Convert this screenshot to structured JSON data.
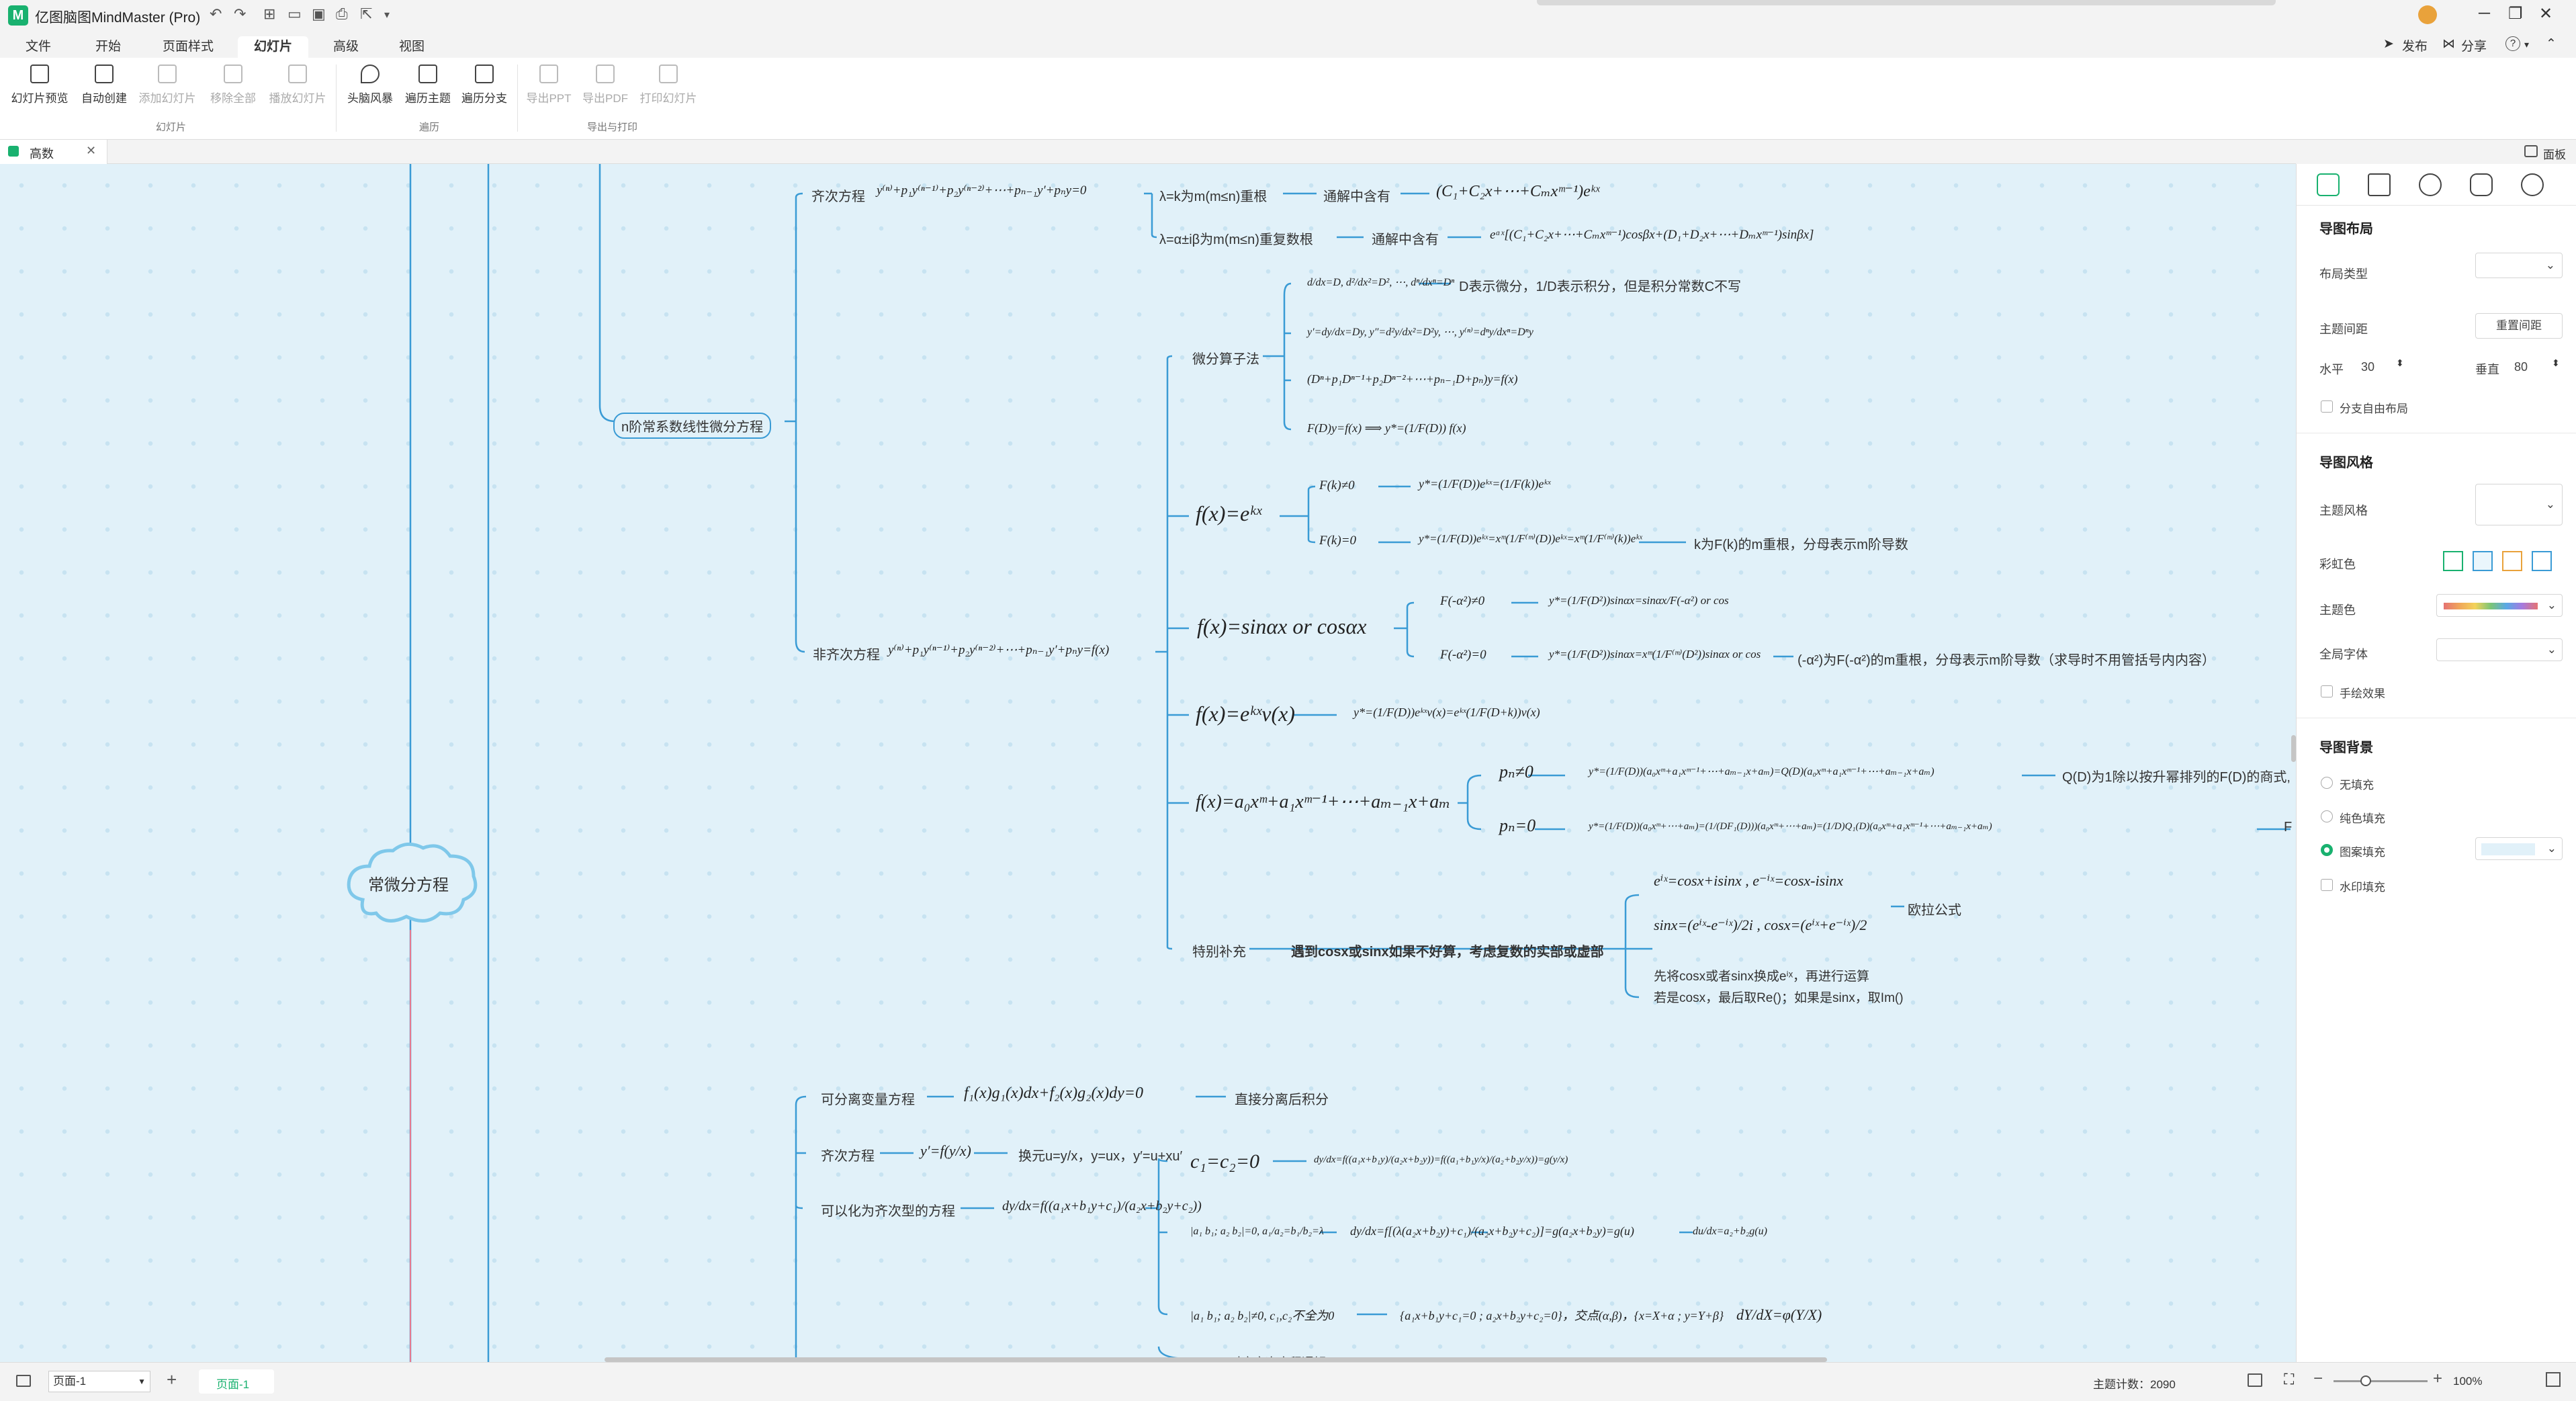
{
  "app": {
    "title": "亿图脑图MindMaster (Pro)"
  },
  "menu": {
    "tabs": [
      "文件",
      "开始",
      "页面样式",
      "幻灯片",
      "高级",
      "视图"
    ],
    "active_index": 3,
    "publish": "发布",
    "share": "分享",
    "help": "?"
  },
  "ribbon": {
    "buttons": [
      {
        "label": "幻灯片预览",
        "enabled": true
      },
      {
        "label": "自动创建",
        "enabled": true
      },
      {
        "label": "添加幻灯片",
        "enabled": false
      },
      {
        "label": "移除全部",
        "enabled": false
      },
      {
        "label": "播放幻灯片",
        "enabled": false
      },
      {
        "label": "头脑风暴",
        "enabled": true
      },
      {
        "label": "遍历主题",
        "enabled": true
      },
      {
        "label": "遍历分支",
        "enabled": true
      },
      {
        "label": "导出PPT",
        "enabled": false
      },
      {
        "label": "导出PDF",
        "enabled": false
      },
      {
        "label": "打印幻灯片",
        "enabled": false
      }
    ],
    "groups": [
      "幻灯片",
      "遍历",
      "导出与打印"
    ]
  },
  "doc": {
    "tab": "高数",
    "panel_toggle": "面板"
  },
  "map": {
    "root": "常微分方程",
    "n_order": "n阶常系数线性微分方程",
    "homog": "齐次方程",
    "homog_eq": "y⁽ⁿ⁾+p₁y⁽ⁿ⁻¹⁾+p₂y⁽ⁿ⁻²⁾+⋯+pₙ₋₁y′+pₙy=0",
    "case_real": "λ=k为m(m≤n)重根",
    "case_complex": "λ=α±iβ为m(m≤n)重复数根",
    "general_has": "通解中含有",
    "general_has2": "通解中含有",
    "sol_real": "(C₁+C₂x+⋯+Cₘxᵐ⁻¹)eᵏˣ",
    "sol_complex": "eᵅˣ[(C₁+C₂x+⋯+Cₘxᵐ⁻¹)cosβx+(D₁+D₂x+⋯+Dₘxᵐ⁻¹)sinβx]",
    "nonhomog": "非齐次方程",
    "nonhomog_eq": "y⁽ⁿ⁾+p₁y⁽ⁿ⁻¹⁾+p₂y⁽ⁿ⁻²⁾+⋯+pₙ₋₁y′+pₙy=f(x)",
    "op_method": "微分算子法",
    "op_def": "d/dx=D, d²/dx²=D², ⋯, dⁿ/dxⁿ=Dⁿ",
    "op_note": "D表示微分，1/D表示积分，但是积分常数C不写",
    "op_y": "y′=dy/dx=Dy, y″=d²y/dx²=D²y, ⋯, y⁽ⁿ⁾=dⁿy/dxⁿ=Dⁿy",
    "op_poly": "(Dⁿ+p₁Dⁿ⁻¹+p₂Dⁿ⁻²+⋯+pₙ₋₁D+pₙ)y=f(x)",
    "op_sol": "F(D)y=f(x) ⟹ y*=(1/F(D)) f(x)",
    "f_exp": "f(x)=eᵏˣ",
    "fk_ne": "F(k)≠0",
    "fk_ne_sol": "y*=(1/F(D))eᵏˣ=(1/F(k))eᵏˣ",
    "fk_eq": "F(k)=0",
    "fk_eq_sol": "y*=(1/F(D))eᵏˣ=xᵐ(1/F⁽ᵐ⁾(D))eᵏˣ=xᵐ(1/F⁽ᵐ⁾(k))eᵏˣ",
    "fk_note": "k为F(k)的m重根，分母表示m阶导数",
    "f_trig": "f(x)=sinαx or cosαx",
    "fa_ne": "F(-α²)≠0",
    "fa_ne_sol": "y*=(1/F(D²))sinαx=sinαx/F(-α²) or cos",
    "fa_eq": "F(-α²)=0",
    "fa_eq_sol": "y*=(1/F(D²))sinαx=xᵐ(1/F⁽ᵐ⁾(D²))sinαx or cos",
    "fa_note": "(-α²)为F(-α²)的m重根，分母表示m阶导数（求导时不用管括号内内容）",
    "f_expv": "f(x)=eᵏˣv(x)",
    "f_expv_sol": "y*=(1/F(D))eᵏˣv(x)=eᵏˣ(1/F(D+k))v(x)",
    "f_poly": "f(x)=a₀xᵐ+a₁xᵐ⁻¹+⋯+aₘ₋₁x+aₘ",
    "pn_ne": "pₙ≠0",
    "pn_ne_sol": "y*=(1/F(D))(a₀xᵐ+a₁xᵐ⁻¹+⋯+aₘ₋₁x+aₘ)=Q(D)(a₀xᵐ+a₁xᵐ⁻¹+⋯+aₘ₋₁x+aₘ)",
    "pn_ne_note": "Q(D)为1除以按升幂排列的F(D)的商式,",
    "pn_eq": "pₙ=0",
    "pn_eq_sol": "y*=(1/F(D))(a₀xᵐ+⋯+aₘ)=(1/(DF₁(D)))(a₀xᵐ+⋯+aₘ)=(1/D)Q₁(D)(a₀xᵐ+a₁xᵐ⁻¹+⋯+aₘ₋₁x+aₘ)",
    "pn_eq_note": "F",
    "special": "特别补充",
    "special_bold": "遇到cosx或sinx如果不好算，考虑复数的实部或虚部",
    "euler1": "eⁱˣ=cosx+isinx , e⁻ⁱˣ=cosx-isinx",
    "euler2": "sinx=(eⁱˣ-e⁻ⁱˣ)/2i , cosx=(eⁱˣ+e⁻ⁱˣ)/2",
    "euler_label": "欧拉公式",
    "special_a": "先将cosx或者sinx换成eⁱˣ，再进行运算",
    "special_b": "若是cosx，最后取Re()；如果是sinx，取Im()",
    "separable": "可分离变量方程",
    "separable_eq": "f₁(x)g₁(x)dx+f₂(x)g₂(x)dy=0",
    "separable_note": "直接分离后积分",
    "homog1": "齐次方程",
    "homog1_eq": "y′=f(y/x)",
    "homog1_note": "换元u=y/x，y=ux，y′=u+xu′",
    "reducible": "可以化为齐次型的方程",
    "reducible_eq": "dy/dx=f((a₁x+b₁y+c₁)/(a₂x+b₂y+c₂))",
    "c_zero": "c₁=c₂=0",
    "c_zero_sol": "dy/dx=f((a₁x+b₁y)/(a₂x+b₂y))=f((a₁+b₁y/x)/(a₂+b₂y/x))=g(y/x)",
    "det_zero": "|a₁ b₁; a₂ b₂|=0, a₁/a₂=b₁/b₂=λ",
    "det_zero_sol": "dy/dx=f[(λ(a₂x+b₂y)+c₁)/(a₂x+b₂y+c₂)]=g(a₂x+b₂y)=g(u)",
    "det_zero_sol2": "du/dx=a₂+b₂g(u)",
    "det_nz": "|a₁ b₁; a₂ b₂|≠0, c₁,c₂不全为0",
    "det_nz_sys": "{a₁x+b₁y+c₁=0 ; a₂x+b₂y+c₂=0}，交点(α,β)，{x=X+α ; y=Y+β}",
    "det_nz_sol": "dY/dX=φ(Y/X)",
    "cut": "对应齐次方程通解"
  },
  "panel": {
    "layout_title": "导图布局",
    "layout_type": "布局类型",
    "spacing": "主题间距",
    "reset": "重置间距",
    "horizontal": "水平",
    "h_val": "30",
    "vertical": "垂直",
    "v_val": "80",
    "free_layout": "分支自由布局",
    "style_title": "导图风格",
    "theme_style": "主题风格",
    "rainbow": "彩虹色",
    "theme_color": "主题色",
    "font": "全局字体",
    "hand": "手绘效果",
    "bg_title": "导图背景",
    "bg_none": "无填充",
    "bg_solid": "纯色填充",
    "bg_pattern": "图案填充",
    "bg_watermark": "水印填充",
    "colors": {
      "accent": "#19b16f",
      "branch": "#3a9bd5",
      "root": "#7fc8ea"
    }
  },
  "status": {
    "page_select": "页面-1",
    "page_tab": "页面-1",
    "count": "主题计数：2090",
    "zoom": "100%"
  }
}
